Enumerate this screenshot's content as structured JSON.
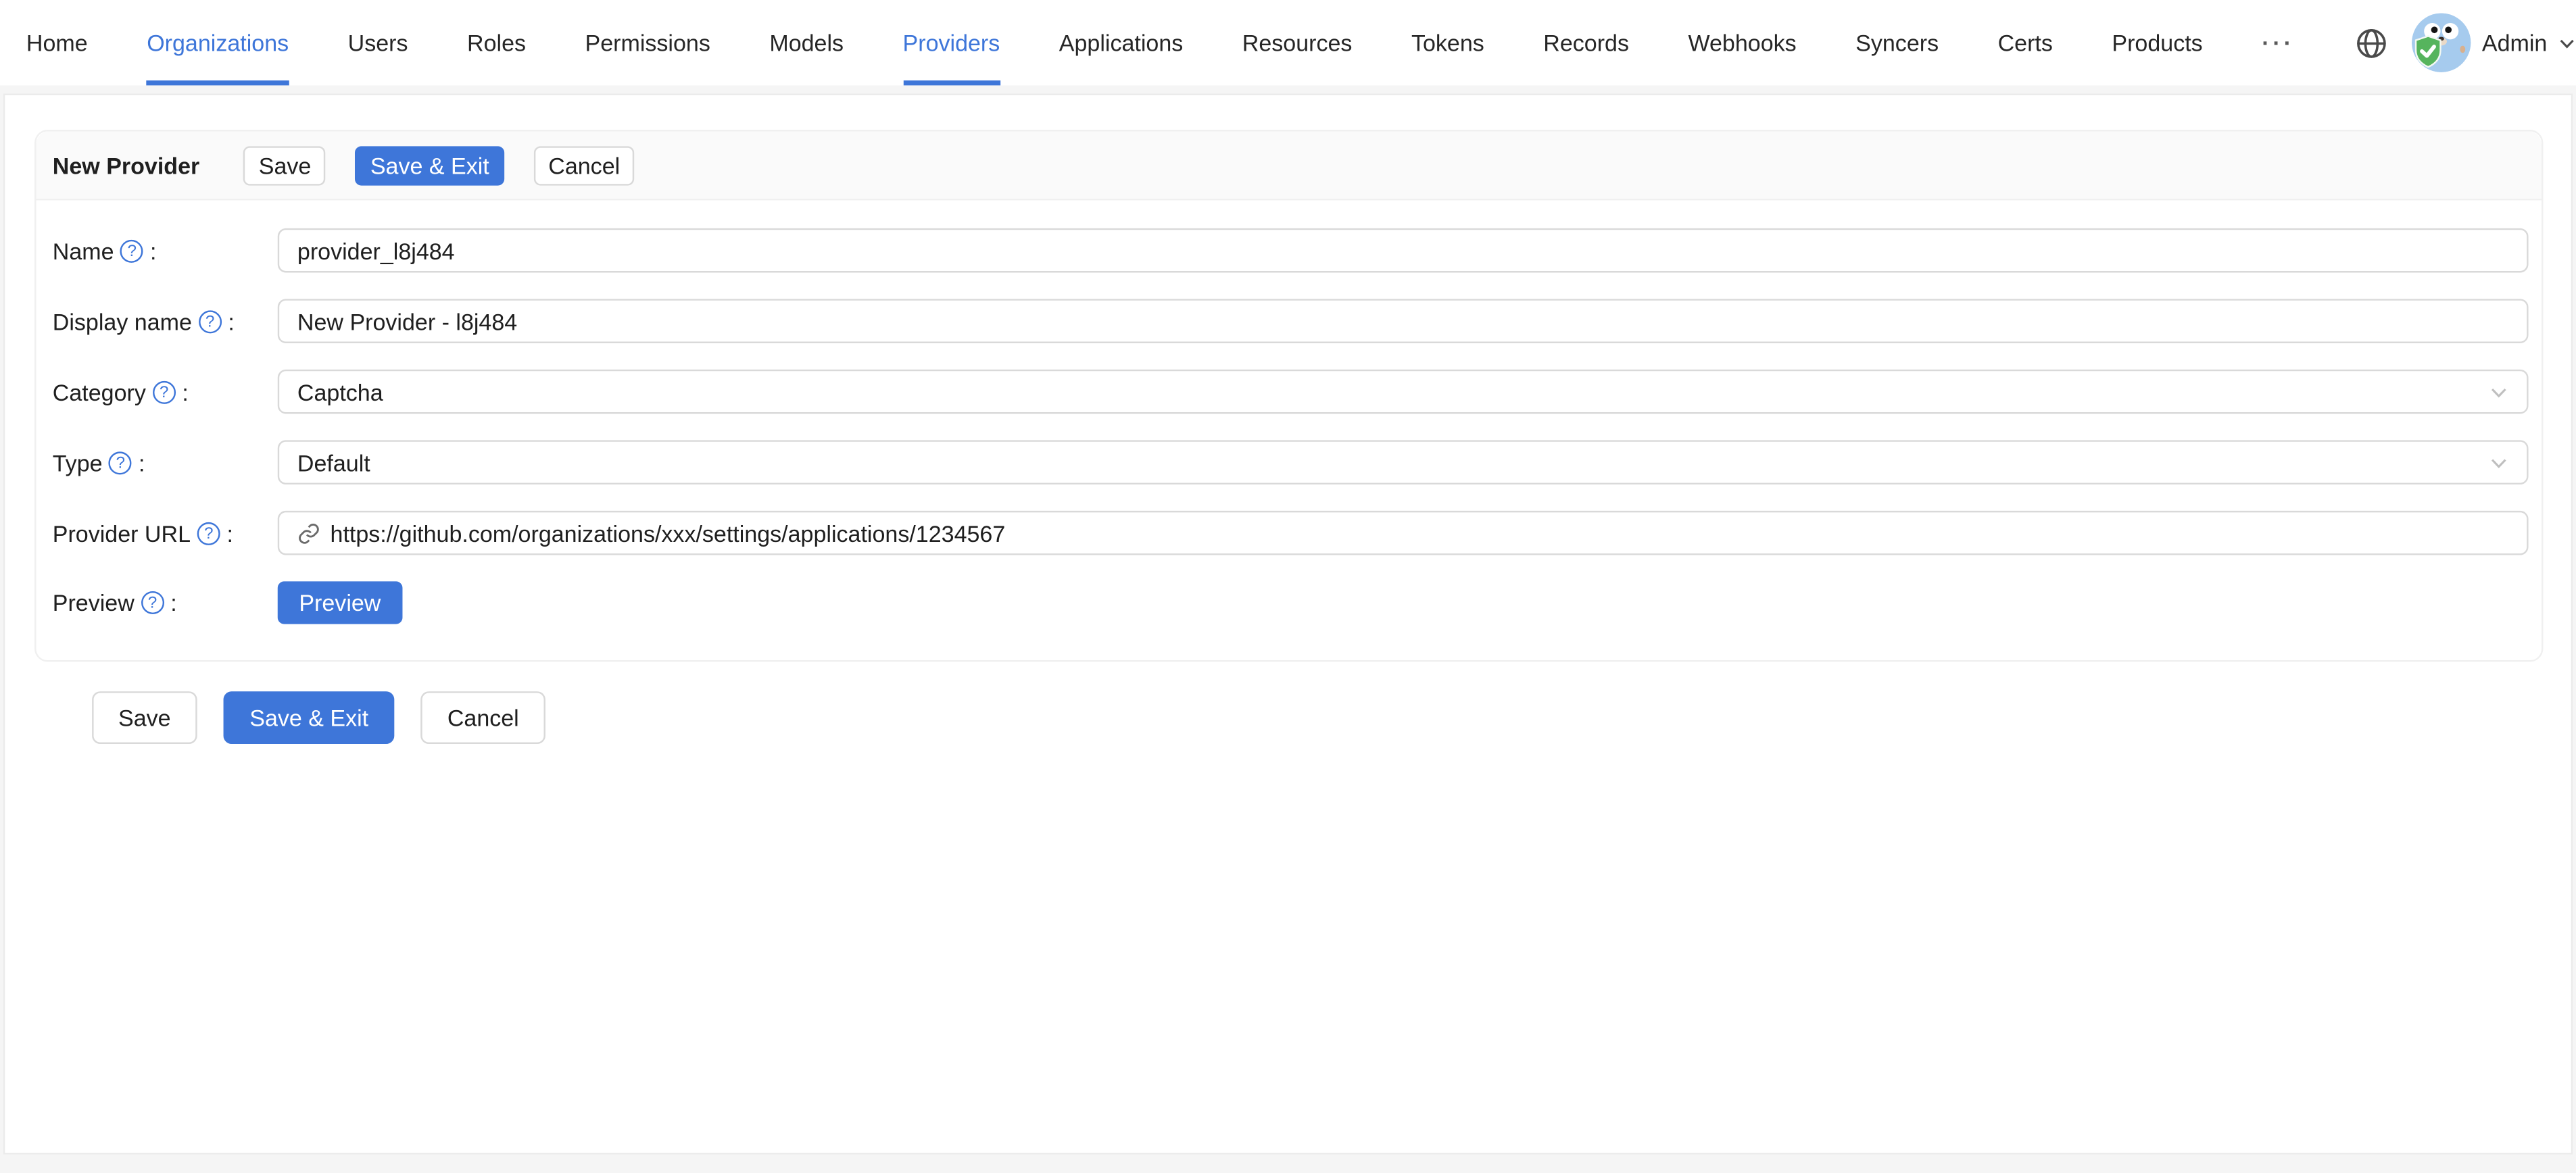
{
  "nav": {
    "items": [
      {
        "label": "Home",
        "active": false
      },
      {
        "label": "Organizations",
        "active": true
      },
      {
        "label": "Users",
        "active": false
      },
      {
        "label": "Roles",
        "active": false
      },
      {
        "label": "Permissions",
        "active": false
      },
      {
        "label": "Models",
        "active": false
      },
      {
        "label": "Providers",
        "active": true
      },
      {
        "label": "Applications",
        "active": false
      },
      {
        "label": "Resources",
        "active": false
      },
      {
        "label": "Tokens",
        "active": false
      },
      {
        "label": "Records",
        "active": false
      },
      {
        "label": "Webhooks",
        "active": false
      },
      {
        "label": "Syncers",
        "active": false
      },
      {
        "label": "Certs",
        "active": false
      },
      {
        "label": "Products",
        "active": false
      }
    ],
    "overflow_label": "···"
  },
  "user": {
    "name": "Admin",
    "language_icon": "globe-icon",
    "avatar_icon": "casdoor-gopher-avatar",
    "dropdown_icon": "chevron-down-icon"
  },
  "card": {
    "title": "New Provider",
    "save_label": "Save",
    "save_exit_label": "Save & Exit",
    "cancel_label": "Cancel"
  },
  "form": {
    "label_suffix": ":",
    "help_icon_glyph": "?",
    "fields": [
      {
        "label": "Name",
        "help_icon": "question-circle-icon",
        "type": "input",
        "value": "provider_l8j484"
      },
      {
        "label": "Display name",
        "help_icon": "question-circle-icon",
        "type": "input",
        "value": "New Provider - l8j484"
      },
      {
        "label": "Category",
        "help_icon": "question-circle-icon",
        "type": "select",
        "value": "Captcha"
      },
      {
        "label": "Type",
        "help_icon": "question-circle-icon",
        "type": "select",
        "value": "Default"
      },
      {
        "label": "Provider URL",
        "help_icon": "question-circle-icon",
        "type": "input-with-link-icon",
        "value": "https://github.com/organizations/xxx/settings/applications/1234567"
      },
      {
        "label": "Preview",
        "help_icon": "question-circle-icon",
        "type": "button",
        "value": "Preview"
      }
    ]
  },
  "footer": {
    "save_label": "Save",
    "save_exit_label": "Save & Exit",
    "cancel_label": "Cancel"
  },
  "colors": {
    "primary": "#3e76d9",
    "nav_active": "#3e76d9",
    "page_background": "#f5f5f5",
    "card_head_background": "#fafafa",
    "border": "#d9d9d9",
    "avatar_blue": "#a6cbee",
    "shield_green": "#56b45d"
  }
}
